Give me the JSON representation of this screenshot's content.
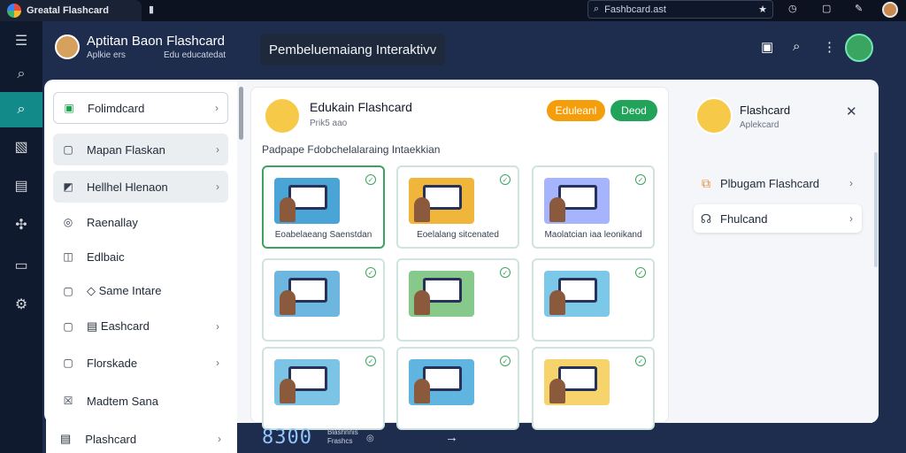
{
  "browser": {
    "tab_title": "Greatal Flashcard",
    "newtab_icon": "bookmark-icon",
    "search_text": "Fashbcard.ast"
  },
  "rail": {
    "items": [
      {
        "name": "menu-icon",
        "glyph": "☰"
      },
      {
        "name": "search-icon",
        "glyph": "⌕"
      },
      {
        "name": "active-search-icon",
        "glyph": "⌕",
        "active": true
      },
      {
        "name": "cards-icon",
        "glyph": "▧"
      },
      {
        "name": "calendar-icon",
        "glyph": "▤"
      },
      {
        "name": "puzzle-icon",
        "glyph": "✣"
      },
      {
        "name": "chat-icon",
        "glyph": "▭"
      },
      {
        "name": "settings-icon",
        "glyph": "⚙"
      }
    ]
  },
  "header": {
    "title": "Aptitan Baon Flashcard",
    "sub1": "Aplkie ers",
    "sub2": "Edu educatedat",
    "badge": "Pembeluemaiang Interaktivv"
  },
  "menu": {
    "items": [
      {
        "label": "Folimdcard",
        "icon": "▣",
        "chevron": true
      },
      {
        "label": "Mapan Flaskan",
        "icon": "▢",
        "chevron": true
      },
      {
        "label": "Hellhel Hlenaon",
        "icon": "◩",
        "chevron": true
      },
      {
        "label": "Raenallay",
        "icon": "◎",
        "chevron": false
      },
      {
        "label": "Edlbaic",
        "icon": "◫",
        "chevron": false
      },
      {
        "label": "Same Intare",
        "icon": "◇",
        "chevron": false
      },
      {
        "label": "Eashcard",
        "icon": "▤",
        "chevron": true
      },
      {
        "label": "Florskade",
        "icon": "▢",
        "chevron": true
      },
      {
        "label": "Madtem Sana",
        "icon": "☒",
        "chevron": false
      }
    ],
    "bottom_item": "Plashcard"
  },
  "center": {
    "title": "Edukain Flashcard",
    "subtitle": "Prik5 aao",
    "btn_primary": "Eduleanl",
    "btn_secondary": "Deod",
    "description": "Padpape Fdobchelalaraing Intaekkian",
    "tiles": [
      {
        "label": "Eoabelaeang Saenstdan",
        "color": "#4aa4d6"
      },
      {
        "label": "Eoelalang sitcenated",
        "color": "#f0b63c"
      },
      {
        "label": "Maolatcian iaa leonikand",
        "color": "#a5b4fc"
      },
      {
        "label": "",
        "color": "#6cb6e0"
      },
      {
        "label": "",
        "color": "#86c98a"
      },
      {
        "label": "",
        "color": "#7cc8e8"
      },
      {
        "label": "",
        "color": "#7cc4e6"
      },
      {
        "label": "",
        "color": "#5fb4e0"
      },
      {
        "label": "",
        "color": "#f7d36b"
      }
    ]
  },
  "right": {
    "title": "Flashcard",
    "subtitle": "Aplekcard",
    "items": [
      {
        "label": "Plbugam Flashcard",
        "icon": "⧉"
      },
      {
        "label": "Fhulcand",
        "icon": "☊"
      }
    ]
  },
  "footer": {
    "counter": "8300",
    "counter_sub1": "Blashnnis",
    "counter_sub2": "Frashcs"
  }
}
